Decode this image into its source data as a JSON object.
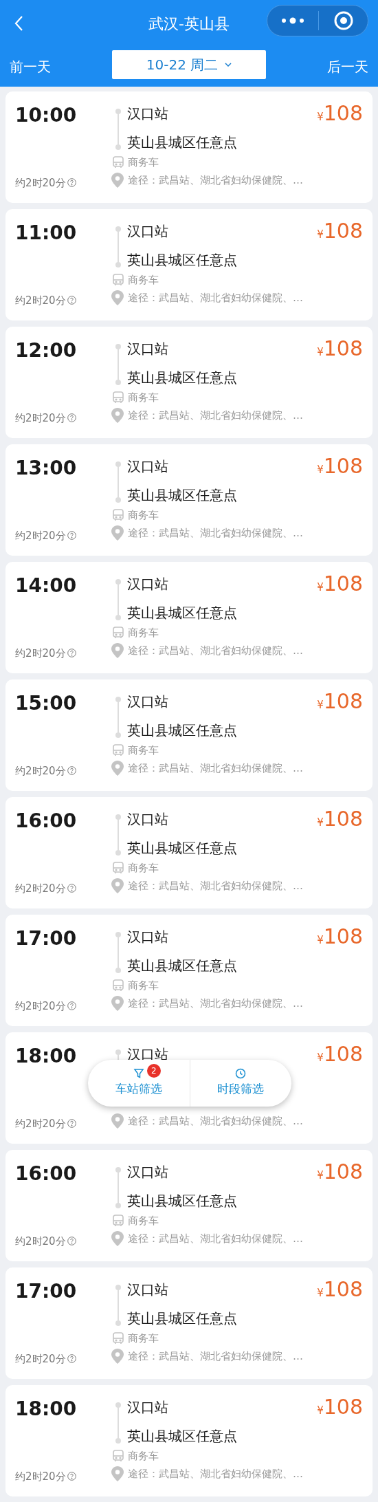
{
  "header": {
    "title": "武汉-英山县",
    "prev_day": "前一天",
    "date": "10-22 周二",
    "next_day": "后一天"
  },
  "trips": [
    {
      "time": "10:00",
      "origin": "汉口站",
      "destination": "英山县城区任意点",
      "vehicle": "商务车",
      "duration": "约2时20分",
      "route": "途径：武昌站、湖北省妇幼保健院、…",
      "currency": "¥",
      "price": "108"
    },
    {
      "time": "11:00",
      "origin": "汉口站",
      "destination": "英山县城区任意点",
      "vehicle": "商务车",
      "duration": "约2时20分",
      "route": "途径：武昌站、湖北省妇幼保健院、…",
      "currency": "¥",
      "price": "108"
    },
    {
      "time": "12:00",
      "origin": "汉口站",
      "destination": "英山县城区任意点",
      "vehicle": "商务车",
      "duration": "约2时20分",
      "route": "途径：武昌站、湖北省妇幼保健院、…",
      "currency": "¥",
      "price": "108"
    },
    {
      "time": "13:00",
      "origin": "汉口站",
      "destination": "英山县城区任意点",
      "vehicle": "商务车",
      "duration": "约2时20分",
      "route": "途径：武昌站、湖北省妇幼保健院、…",
      "currency": "¥",
      "price": "108"
    },
    {
      "time": "14:00",
      "origin": "汉口站",
      "destination": "英山县城区任意点",
      "vehicle": "商务车",
      "duration": "约2时20分",
      "route": "途径：武昌站、湖北省妇幼保健院、…",
      "currency": "¥",
      "price": "108"
    },
    {
      "time": "15:00",
      "origin": "汉口站",
      "destination": "英山县城区任意点",
      "vehicle": "商务车",
      "duration": "约2时20分",
      "route": "途径：武昌站、湖北省妇幼保健院、…",
      "currency": "¥",
      "price": "108"
    },
    {
      "time": "16:00",
      "origin": "汉口站",
      "destination": "英山县城区任意点",
      "vehicle": "商务车",
      "duration": "约2时20分",
      "route": "途径：武昌站、湖北省妇幼保健院、…",
      "currency": "¥",
      "price": "108"
    },
    {
      "time": "17:00",
      "origin": "汉口站",
      "destination": "英山县城区任意点",
      "vehicle": "商务车",
      "duration": "约2时20分",
      "route": "途径：武昌站、湖北省妇幼保健院、…",
      "currency": "¥",
      "price": "108"
    },
    {
      "time": "18:00",
      "origin": "汉口站",
      "duration": "约2时20分",
      "route": "途径：武昌站、湖北省妇幼保健院、…",
      "currency": "¥",
      "price": "108"
    },
    {
      "time": "16:00",
      "origin": "汉口站",
      "destination": "英山县城区任意点",
      "vehicle": "商务车",
      "duration": "约2时20分",
      "route": "途径：武昌站、湖北省妇幼保健院、…",
      "currency": "¥",
      "price": "108"
    },
    {
      "time": "17:00",
      "origin": "汉口站",
      "destination": "英山县城区任意点",
      "vehicle": "商务车",
      "duration": "约2时20分",
      "route": "途径：武昌站、湖北省妇幼保健院、…",
      "currency": "¥",
      "price": "108"
    },
    {
      "time": "18:00",
      "origin": "汉口站",
      "destination": "英山县城区任意点",
      "vehicle": "商务车",
      "duration": "约2时20分",
      "route": "途径：武昌站、湖北省妇幼保健院、…",
      "currency": "¥",
      "price": "108"
    }
  ],
  "filters": [
    {
      "kind": "station",
      "label": "车站筛选",
      "badge": "2"
    },
    {
      "kind": "time",
      "label": "时段筛选"
    }
  ]
}
